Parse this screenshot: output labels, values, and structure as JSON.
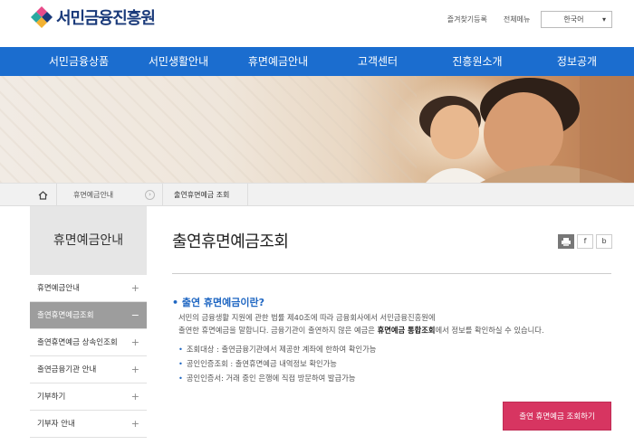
{
  "header": {
    "logo_text": "서민금융진흥원",
    "links": [
      "즐겨찾기등록",
      "전체메뉴"
    ],
    "language": "한국어"
  },
  "nav": {
    "items": [
      "서민금융상품",
      "서민생활안내",
      "휴면예금안내",
      "고객센터",
      "진흥원소개",
      "정보공개"
    ]
  },
  "breadcrumb": {
    "level1": "휴면예금안내",
    "level2": "출연휴면예금 조회"
  },
  "sidebar": {
    "title": "휴면예금안내",
    "items": [
      {
        "label": "휴면예금안내",
        "state": "+"
      },
      {
        "label": "출연휴면예금조회",
        "state": "−"
      },
      {
        "label": "출연휴면예금 상속인조회",
        "state": "+"
      },
      {
        "label": "출연금융기관 안내",
        "state": "+"
      },
      {
        "label": "기부하기",
        "state": "+"
      },
      {
        "label": "기부자 안내",
        "state": "+"
      }
    ]
  },
  "main": {
    "title": "출연휴면예금조회",
    "share": [
      "f",
      "b"
    ],
    "section_title": "• 출연 휴면예금이란?",
    "desc_line1": "서민의 금융생활 지원에 관한 법률 제40조에 따라 금융회사에서 서민금융진흥원에",
    "desc_line2_pre": "출연한 휴면예금을 말합니다. 금융기관이 출연하지 않은 예금은 ",
    "desc_line2_bold": "휴면예금 통합조회",
    "desc_line2_post": "에서 정보를 확인하실 수 있습니다.",
    "bullets": [
      "조회대상 : 출연금융기관에서 제공한 계좌에 한하여 확인가능",
      "공인인증조회 : 출연휴면예금 내역정보 확인가능",
      "공인인증서: 거래 중인 은행에 직접 방문하여 발급가능"
    ],
    "cta_label": "출연 휴면예금 조회하기"
  },
  "colors": {
    "nav_bg": "#1b6dcf",
    "accent_blue": "#1e66c2",
    "cta_pink": "#d73561",
    "sidebar_active": "#9d9d9d"
  }
}
